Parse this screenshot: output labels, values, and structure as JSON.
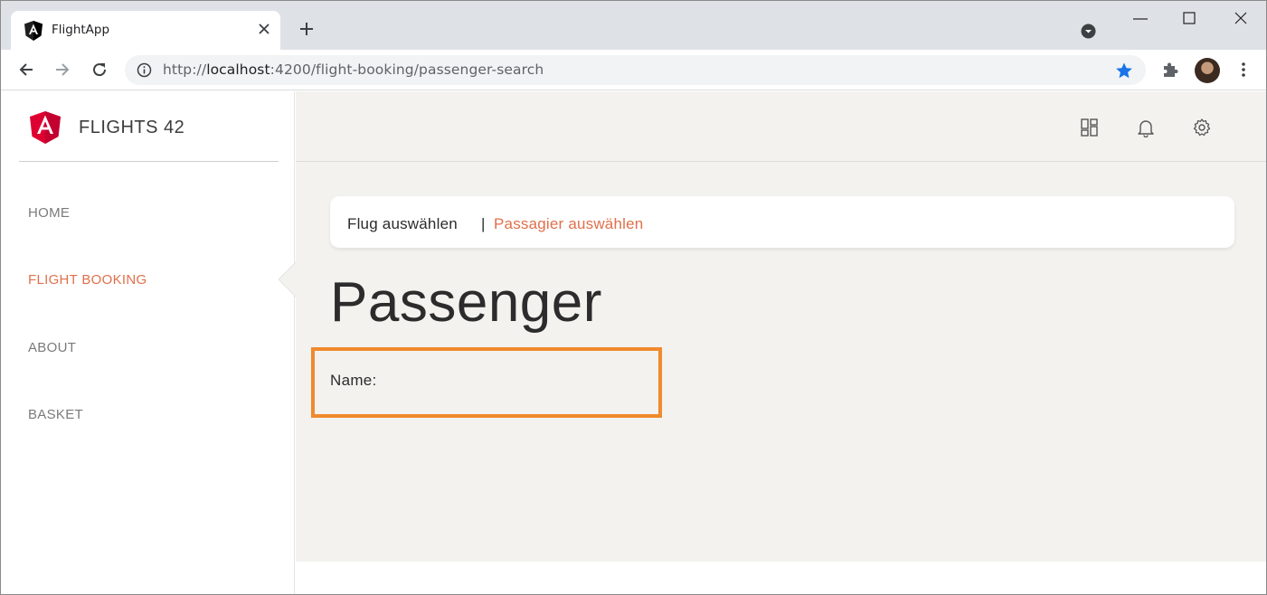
{
  "browser": {
    "tab_title": "FlightApp",
    "url_prefix": "http://",
    "url_host": "localhost",
    "url_rest": ":4200/flight-booking/passenger-search",
    "accent_color": "#1a73e8"
  },
  "app": {
    "brand": "FLIGHTS 42",
    "nav": [
      {
        "label": "HOME",
        "active": false
      },
      {
        "label": "FLIGHT BOOKING",
        "active": true
      },
      {
        "label": "ABOUT",
        "active": false
      },
      {
        "label": "BASKET",
        "active": false
      }
    ],
    "topbar_icons": [
      "dashboard-icon",
      "bell-icon",
      "gear-icon"
    ],
    "breadcrumb": {
      "step1": "Flug auswählen",
      "separator": "|",
      "step2": "Passagier auswählen"
    },
    "page_title": "Passenger",
    "name_label": "Name:",
    "colors": {
      "active_accent": "#e0704b",
      "highlight_border": "#f08a2c",
      "main_background": "#f3f2ef",
      "logo_red": "#dd0031"
    }
  }
}
